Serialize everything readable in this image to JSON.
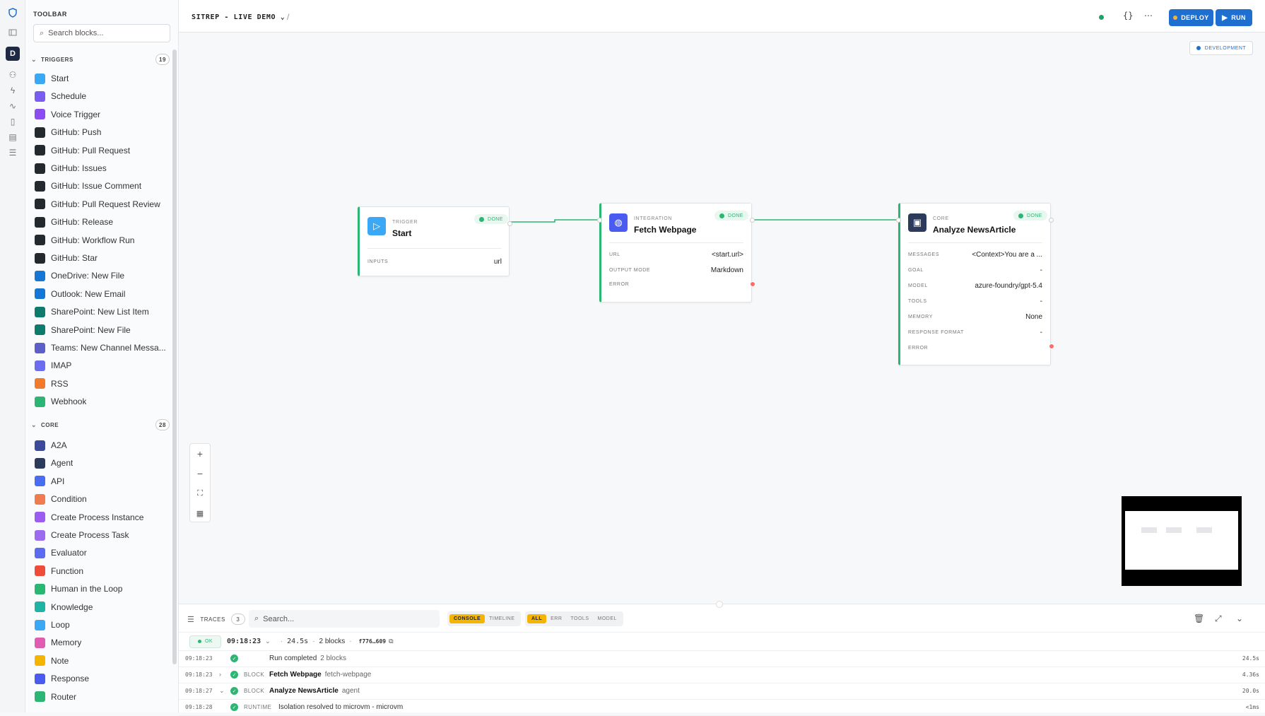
{
  "sidebar": {
    "title": "TOOLBAR",
    "search_placeholder": "Search blocks...",
    "triggers": {
      "label": "TRIGGERS",
      "count": "19",
      "items": [
        {
          "label": "Start",
          "color": "#3aa8f5"
        },
        {
          "label": "Schedule",
          "color": "#7b5cf0"
        },
        {
          "label": "Voice Trigger",
          "color": "#8b4cf0"
        },
        {
          "label": "GitHub: Push",
          "color": "#24292f"
        },
        {
          "label": "GitHub: Pull Request",
          "color": "#24292f"
        },
        {
          "label": "GitHub: Issues",
          "color": "#24292f"
        },
        {
          "label": "GitHub: Issue Comment",
          "color": "#24292f"
        },
        {
          "label": "GitHub: Pull Request Review",
          "color": "#24292f"
        },
        {
          "label": "GitHub: Release",
          "color": "#24292f"
        },
        {
          "label": "GitHub: Workflow Run",
          "color": "#24292f"
        },
        {
          "label": "GitHub: Star",
          "color": "#24292f"
        },
        {
          "label": "OneDrive: New File",
          "color": "#1576d6"
        },
        {
          "label": "Outlook: New Email",
          "color": "#1576d6"
        },
        {
          "label": "SharePoint: New List Item",
          "color": "#0f7b6c"
        },
        {
          "label": "SharePoint: New File",
          "color": "#0f7b6c"
        },
        {
          "label": "Teams: New Channel Messa...",
          "color": "#5b5fc7"
        },
        {
          "label": "IMAP",
          "color": "#6c6cf0"
        },
        {
          "label": "RSS",
          "color": "#f07b2c"
        },
        {
          "label": "Webhook",
          "color": "#2bb673"
        }
      ]
    },
    "core": {
      "label": "CORE",
      "count": "28",
      "items": [
        {
          "label": "A2A",
          "color": "#3b4a9a"
        },
        {
          "label": "Agent",
          "color": "#2c3a5c"
        },
        {
          "label": "API",
          "color": "#4a6cf0"
        },
        {
          "label": "Condition",
          "color": "#f07b4c"
        },
        {
          "label": "Create Process Instance",
          "color": "#9b5cf0"
        },
        {
          "label": "Create Process Task",
          "color": "#9b6cf0"
        },
        {
          "label": "Evaluator",
          "color": "#5b6cf0"
        },
        {
          "label": "Function",
          "color": "#f04c3c"
        },
        {
          "label": "Human in the Loop",
          "color": "#2bb673"
        },
        {
          "label": "Knowledge",
          "color": "#1fb3a3"
        },
        {
          "label": "Loop",
          "color": "#3aa8f5"
        },
        {
          "label": "Memory",
          "color": "#e05cb0"
        },
        {
          "label": "Note",
          "color": "#f5b400"
        },
        {
          "label": "Response",
          "color": "#4a5cf0"
        },
        {
          "label": "Router",
          "color": "#2bb673"
        }
      ]
    }
  },
  "topbar": {
    "workflow_name": "SITREP - LIVE DEMO",
    "slash": "/",
    "deploy_label": "DEPLOY",
    "run_label": "RUN"
  },
  "canvas": {
    "env_badge": "DEVELOPMENT",
    "nodes": {
      "start": {
        "category": "TRIGGER",
        "title": "Start",
        "status": "DONE",
        "rows": [
          {
            "k": "INPUTS",
            "v": "url"
          }
        ]
      },
      "fetch": {
        "category": "INTEGRATION",
        "title": "Fetch Webpage",
        "status": "DONE",
        "rows": [
          {
            "k": "URL",
            "v": "<start.url>"
          },
          {
            "k": "OUTPUT MODE",
            "v": "Markdown"
          },
          {
            "k": "ERROR",
            "v": ""
          }
        ]
      },
      "analyze": {
        "category": "CORE",
        "title": "Analyze NewsArticle",
        "status": "DONE",
        "rows": [
          {
            "k": "MESSAGES",
            "v": "<Context>You are a ..."
          },
          {
            "k": "GOAL",
            "v": "-"
          },
          {
            "k": "MODEL",
            "v": "azure-foundry/gpt-5.4"
          },
          {
            "k": "TOOLS",
            "v": "-"
          },
          {
            "k": "MEMORY",
            "v": "None"
          },
          {
            "k": "RESPONSE FORMAT",
            "v": "-"
          },
          {
            "k": "ERROR",
            "v": ""
          }
        ]
      }
    }
  },
  "panel": {
    "traces_label": "TRACES",
    "traces_count": "3",
    "search_placeholder": "Search...",
    "view_tabs": [
      "CONSOLE",
      "TIMELINE"
    ],
    "filter_tabs": [
      "ALL",
      "ERR",
      "TOOLS",
      "MODEL"
    ],
    "run": {
      "status": "OK",
      "time": "09:18:23",
      "duration": "24.5s",
      "blocks": "2 blocks",
      "id": "f776…609"
    },
    "logs": [
      {
        "ts": "09:18:23",
        "type": "",
        "title": "",
        "text": "Run completed",
        "sub": "2 blocks",
        "dur": "24.5s"
      },
      {
        "ts": "09:18:23",
        "type": "BLOCK",
        "title": "Fetch Webpage",
        "text": "",
        "sub": "fetch-webpage",
        "dur": "4.36s"
      },
      {
        "ts": "09:18:27",
        "type": "BLOCK",
        "title": "Analyze NewsArticle",
        "text": "",
        "sub": "agent",
        "dur": "20.0s"
      },
      {
        "ts": "09:18:28",
        "type": "RUNTIME",
        "title": "",
        "text": "Isolation resolved to microvm - microvm",
        "sub": "",
        "dur": "<1ms"
      }
    ]
  }
}
